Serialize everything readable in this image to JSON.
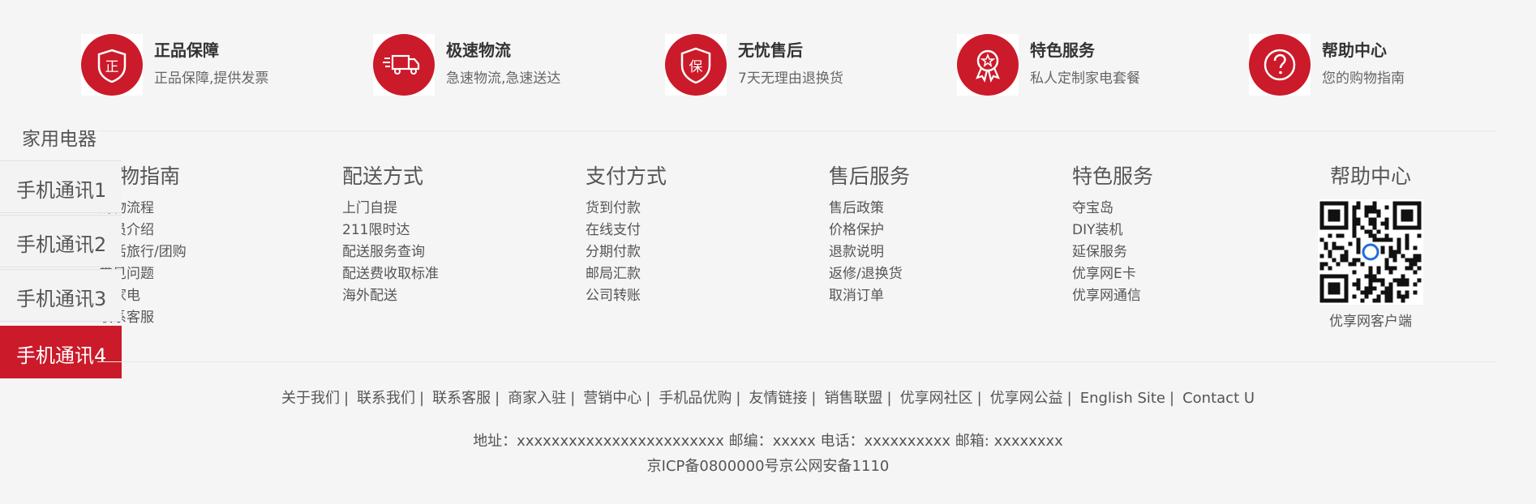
{
  "services": [
    {
      "icon": "genuine-badge-icon",
      "title": "正品保障",
      "desc": "正品保障,提供发票"
    },
    {
      "icon": "delivery-truck-icon",
      "title": "极速物流",
      "desc": "急速物流,急速送达"
    },
    {
      "icon": "shield-guarantee-icon",
      "title": "无忧售后",
      "desc": "7天无理由退换货"
    },
    {
      "icon": "award-medal-icon",
      "title": "特色服务",
      "desc": "私人定制家电套餐"
    },
    {
      "icon": "help-question-icon",
      "title": "帮助中心",
      "desc": "您的购物指南"
    }
  ],
  "side_nav": {
    "category": "家用电器",
    "tabs": [
      "手机通讯1",
      "手机通讯2",
      "手机通讯3",
      "手机通讯4"
    ],
    "active_index": 3
  },
  "columns": [
    {
      "head": "购物指南",
      "links": [
        "购物流程",
        "会员介绍",
        "生活旅行/团购",
        "常见问题",
        "大家电",
        "联系客服"
      ]
    },
    {
      "head": "配送方式",
      "links": [
        "上门自提",
        "211限时达",
        "配送服务查询",
        "配送费收取标准",
        "海外配送"
      ]
    },
    {
      "head": "支付方式",
      "links": [
        "货到付款",
        "在线支付",
        "分期付款",
        "邮局汇款",
        "公司转账"
      ]
    },
    {
      "head": "售后服务",
      "links": [
        "售后政策",
        "价格保护",
        "退款说明",
        "返修/退换货",
        "取消订单"
      ]
    },
    {
      "head": "特色服务",
      "links": [
        "夺宝岛",
        "DIY装机",
        "延保服务",
        "优享网E卡",
        "优享网通信"
      ]
    }
  ],
  "help_center": {
    "head": "帮助中心",
    "qr_caption": "优享网客户端"
  },
  "bottom_links": [
    "关于我们",
    "联系我们",
    "联系客服",
    "商家入驻",
    "营销中心",
    "手机品优购",
    "友情链接",
    "销售联盟",
    "优享网社区",
    "优享网公益",
    "English Site",
    "Contact U"
  ],
  "address_line": "地址：xxxxxxxxxxxxxxxxxxxxxxxx 邮编：xxxxx 电话：xxxxxxxxxx 邮箱: xxxxxxxx",
  "icp_line": "京ICP备0800000号京公网安备1110",
  "colors": {
    "accent": "#cb1a2a",
    "background": "#f5f5f5",
    "text": "#555555"
  }
}
